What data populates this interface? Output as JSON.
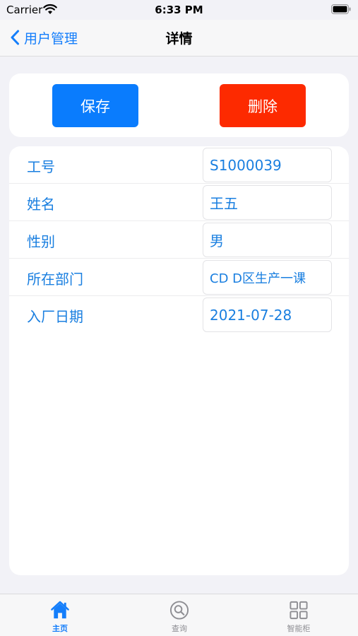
{
  "status_bar": {
    "carrier": "Carrier",
    "time": "6:33 PM"
  },
  "nav": {
    "back_label": "用户管理",
    "title": "详情"
  },
  "actions": {
    "save_label": "保存",
    "delete_label": "删除"
  },
  "form": {
    "rows": [
      {
        "label": "工号",
        "value": "S1000039"
      },
      {
        "label": "姓名",
        "value": "王五"
      },
      {
        "label": "性别",
        "value": "男"
      },
      {
        "label": "所在部门",
        "value": "CD D区生产一课"
      },
      {
        "label": "入厂日期",
        "value": "2021-07-28"
      }
    ]
  },
  "tabbar": {
    "items": [
      {
        "label": "主页",
        "icon": "home-icon",
        "active": true
      },
      {
        "label": "查询",
        "icon": "search-icon",
        "active": false
      },
      {
        "label": "智能柜",
        "icon": "grid-icon",
        "active": false
      }
    ]
  },
  "colors": {
    "accent": "#147efb",
    "save": "#0a7cfd",
    "delete": "#fd2a00",
    "text_blue": "#1a7fe0"
  }
}
